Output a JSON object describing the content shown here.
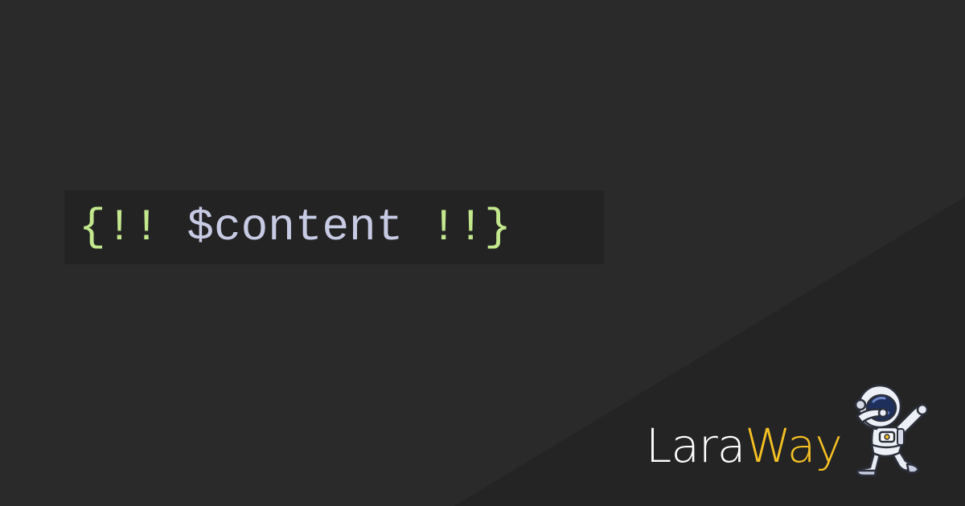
{
  "code": {
    "open": "{!! ",
    "variable": "$content",
    "close": " !!}"
  },
  "brand": {
    "part1": "Lara",
    "part2": "Way"
  },
  "colors": {
    "background": "#2a2a2a",
    "background_shade": "#242424",
    "code_box": "#232323",
    "brace": "#c3e88d",
    "variable": "#c8cbe4",
    "brand_primary": "#ffffff",
    "brand_accent": "#f5c024"
  },
  "mascot": {
    "icon": "dabbing-astronaut-icon"
  }
}
